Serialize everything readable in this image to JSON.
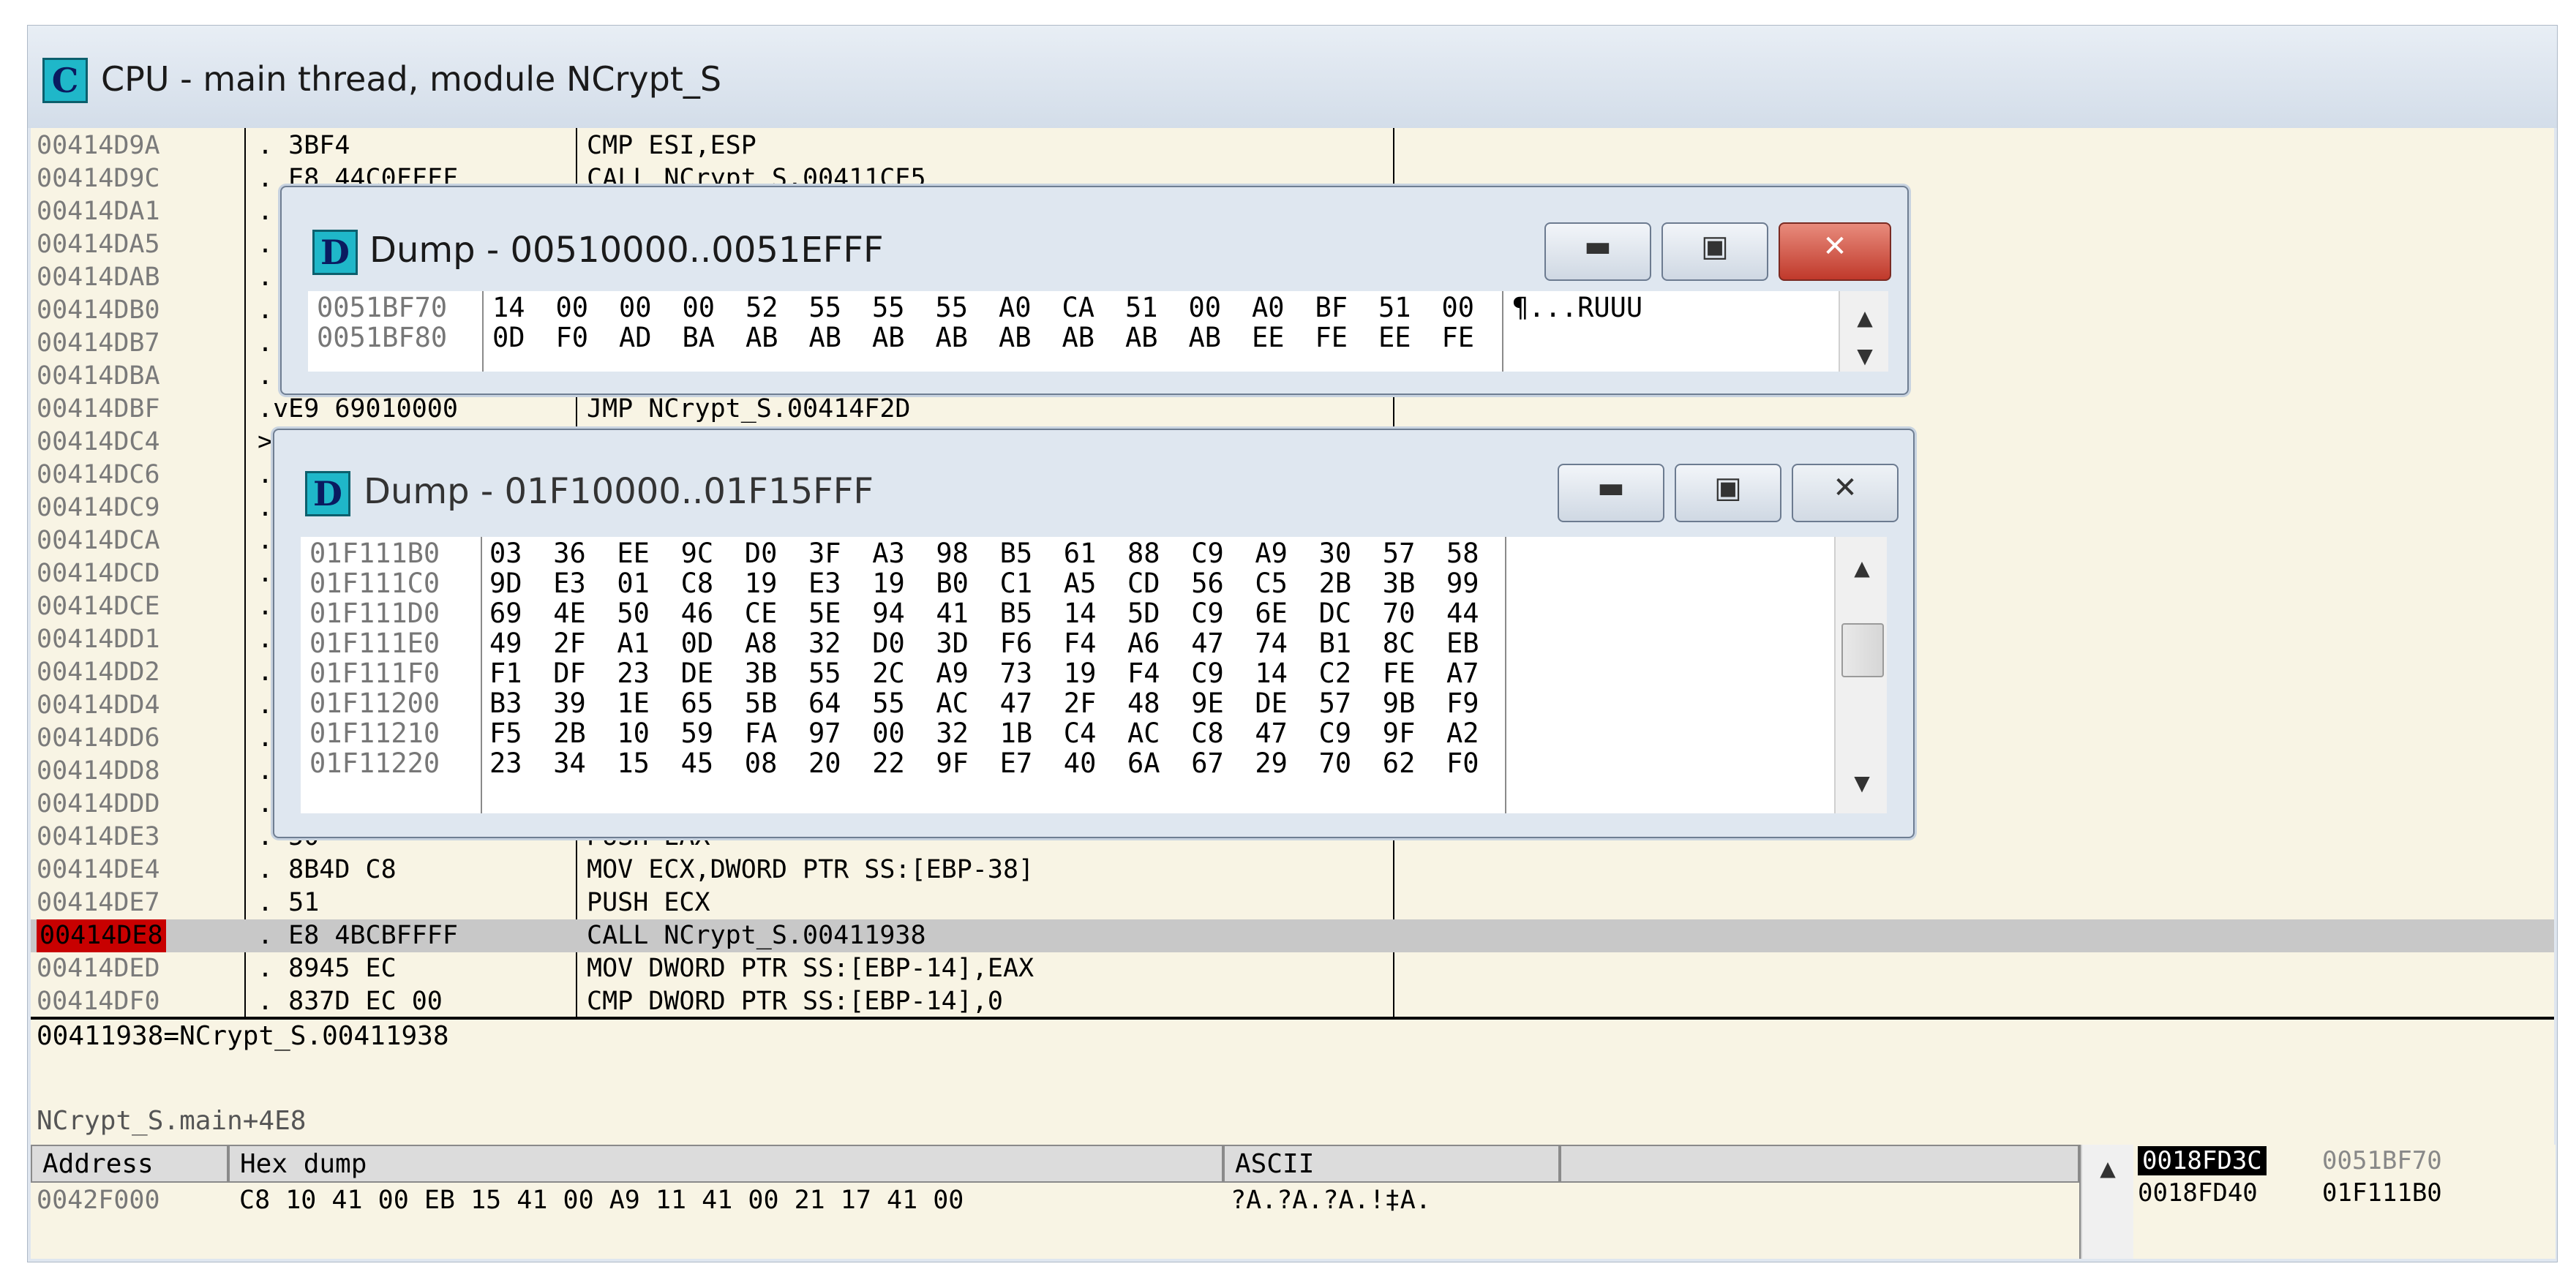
{
  "cpu_window": {
    "title": "CPU - main thread, module NCrypt_S",
    "icon_letter": "C"
  },
  "disassembly": {
    "rows": [
      {
        "addr": "00414D9A",
        "hex": ". 3BF4",
        "asm": "CMP ESI,ESP"
      },
      {
        "addr": "00414D9C",
        "hex": ". E8 44C0FFFF",
        "asm": "CALL NCrypt_S.00411CE5"
      },
      {
        "addr": "00414DA1",
        "hex": ".",
        "asm": ""
      },
      {
        "addr": "00414DA5",
        "hex": ".",
        "asm": ""
      },
      {
        "addr": "00414DAB",
        "hex": ".",
        "asm": ""
      },
      {
        "addr": "00414DB0",
        "hex": ".",
        "asm": ""
      },
      {
        "addr": "00414DB7",
        "hex": ".",
        "asm": ""
      },
      {
        "addr": "00414DBA",
        "hex": ".",
        "asm": ""
      },
      {
        "addr": "00414DBF",
        "hex": ".vE9 69010000",
        "asm": "JMP NCrypt_S.00414F2D"
      },
      {
        "addr": "00414DC4",
        "hex": ">",
        "asm": ""
      },
      {
        "addr": "00414DC6",
        "hex": ".",
        "asm": ""
      },
      {
        "addr": "00414DC9",
        "hex": ".",
        "asm": ""
      },
      {
        "addr": "00414DCA",
        "hex": ".",
        "asm": ""
      },
      {
        "addr": "00414DCD",
        "hex": ".",
        "asm": ""
      },
      {
        "addr": "00414DCE",
        "hex": ".",
        "asm": ""
      },
      {
        "addr": "00414DD1",
        "hex": ".",
        "asm": ""
      },
      {
        "addr": "00414DD2",
        "hex": ".",
        "asm": ""
      },
      {
        "addr": "00414DD4",
        "hex": ".",
        "asm": ""
      },
      {
        "addr": "00414DD6",
        "hex": ".",
        "asm": ""
      },
      {
        "addr": "00414DD8",
        "hex": ".",
        "asm": ""
      },
      {
        "addr": "00414DDD",
        "hex": ".",
        "asm": ""
      },
      {
        "addr": "00414DE3",
        "hex": ". 50",
        "asm": "PUSH EAX"
      },
      {
        "addr": "00414DE4",
        "hex": ". 8B4D C8",
        "asm": "MOV ECX,DWORD PTR SS:[EBP-38]"
      },
      {
        "addr": "00414DE7",
        "hex": ". 51",
        "asm": "PUSH ECX"
      },
      {
        "addr": "00414DE8",
        "hex": ". E8 4BCBFFFF",
        "asm": "CALL NCrypt_S.00411938"
      },
      {
        "addr": "00414DED",
        "hex": ". 8945 EC",
        "asm": "MOV DWORD PTR SS:[EBP-14],EAX"
      },
      {
        "addr": "00414DF0",
        "hex": ". 837D EC 00",
        "asm": "CMP DWORD PTR SS:[EBP-14],0"
      }
    ]
  },
  "info": {
    "line1": "00411938=NCrypt_S.00411938",
    "line2": "NCrypt_S.main+4E8"
  },
  "hex_pane": {
    "col_address": "Address",
    "col_hex": "Hex dump",
    "col_ascii": "ASCII",
    "row_addr": "0042F000",
    "row_hex": "C8 10 41 00 EB 15 41 00 A9 11 41 00 21 17 41 00",
    "row_ascii": "?A.?A.?A.!‡A."
  },
  "stack": {
    "row1_addr": "0018FD3C",
    "row1_val": "0051BF70",
    "row2_addr": "0018FD40",
    "row2_val": "01F111B0"
  },
  "dump1": {
    "title": "Dump - 00510000..0051EFFF",
    "icon_letter": "D",
    "rows": [
      {
        "addr": "0051BF70",
        "bytes": [
          "14",
          "00",
          "00",
          "00",
          "52",
          "55",
          "55",
          "55",
          "A0",
          "CA",
          "51",
          "00",
          "A0",
          "BF",
          "51",
          "00"
        ],
        "ascii": "¶...RUUU"
      },
      {
        "addr": "0051BF80",
        "bytes": [
          "0D",
          "F0",
          "AD",
          "BA",
          "AB",
          "AB",
          "AB",
          "AB",
          "AB",
          "AB",
          "AB",
          "AB",
          "EE",
          "FE",
          "EE",
          "FE"
        ],
        "ascii": ""
      }
    ]
  },
  "dump2": {
    "title": "Dump - 01F10000..01F15FFF",
    "icon_letter": "D",
    "rows": [
      {
        "addr": "01F111B0",
        "bytes": [
          "03",
          "36",
          "EE",
          "9C",
          "D0",
          "3F",
          "A3",
          "98",
          "B5",
          "61",
          "88",
          "C9",
          "A9",
          "30",
          "57",
          "58"
        ]
      },
      {
        "addr": "01F111C0",
        "bytes": [
          "9D",
          "E3",
          "01",
          "C8",
          "19",
          "E3",
          "19",
          "B0",
          "C1",
          "A5",
          "CD",
          "56",
          "C5",
          "2B",
          "3B",
          "99"
        ]
      },
      {
        "addr": "01F111D0",
        "bytes": [
          "69",
          "4E",
          "50",
          "46",
          "CE",
          "5E",
          "94",
          "41",
          "B5",
          "14",
          "5D",
          "C9",
          "6E",
          "DC",
          "70",
          "44"
        ]
      },
      {
        "addr": "01F111E0",
        "bytes": [
          "49",
          "2F",
          "A1",
          "0D",
          "A8",
          "32",
          "D0",
          "3D",
          "F6",
          "F4",
          "A6",
          "47",
          "74",
          "B1",
          "8C",
          "EB"
        ]
      },
      {
        "addr": "01F111F0",
        "bytes": [
          "F1",
          "DF",
          "23",
          "DE",
          "3B",
          "55",
          "2C",
          "A9",
          "73",
          "19",
          "F4",
          "C9",
          "14",
          "C2",
          "FE",
          "A7"
        ]
      },
      {
        "addr": "01F11200",
        "bytes": [
          "B3",
          "39",
          "1E",
          "65",
          "5B",
          "64",
          "55",
          "AC",
          "47",
          "2F",
          "48",
          "9E",
          "DE",
          "57",
          "9B",
          "F9"
        ]
      },
      {
        "addr": "01F11210",
        "bytes": [
          "F5",
          "2B",
          "10",
          "59",
          "FA",
          "97",
          "00",
          "32",
          "1B",
          "C4",
          "AC",
          "C8",
          "47",
          "C9",
          "9F",
          "A2"
        ]
      },
      {
        "addr": "01F11220",
        "bytes": [
          "23",
          "34",
          "15",
          "45",
          "08",
          "20",
          "22",
          "9F",
          "E7",
          "40",
          "6A",
          "67",
          "29",
          "70",
          "62",
          "F0"
        ]
      }
    ]
  },
  "buttons": {
    "minimize": "▬",
    "maximize": "▣",
    "close": "✕"
  }
}
